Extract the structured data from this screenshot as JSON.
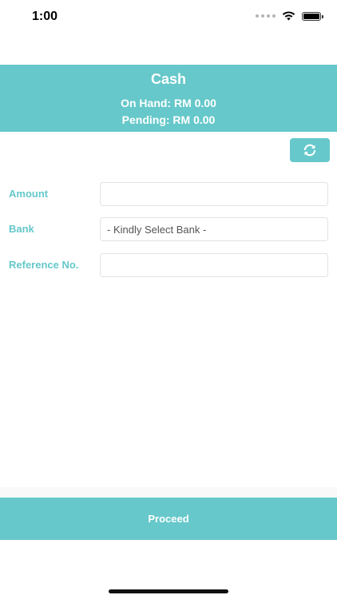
{
  "status_bar": {
    "time": "1:00",
    "icons": [
      "signal-icon",
      "wifi-icon",
      "battery-icon"
    ]
  },
  "header": {
    "title": "Cash",
    "on_hand": "On Hand: RM 0.00",
    "pending": "Pending: RM 0.00"
  },
  "toolbar": {
    "refresh_icon": "refresh-icon"
  },
  "form": {
    "amount_label": "Amount",
    "amount_value": "",
    "bank_label": "Bank",
    "bank_value": "- Kindly Select Bank -",
    "reference_label": "Reference No.",
    "reference_value": ""
  },
  "footer": {
    "proceed_label": "Proceed"
  },
  "colors": {
    "accent": "#66c8ca",
    "field_border": "#e2e2e2"
  }
}
